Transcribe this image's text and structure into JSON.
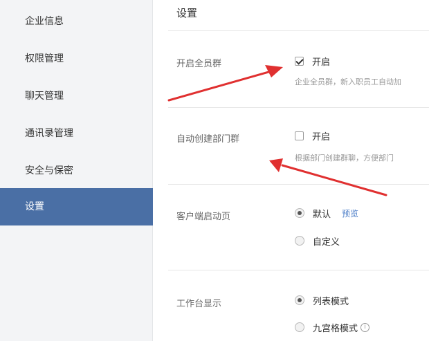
{
  "sidebar": {
    "items": [
      {
        "label": "企业信息"
      },
      {
        "label": "权限管理"
      },
      {
        "label": "聊天管理"
      },
      {
        "label": "通讯录管理"
      },
      {
        "label": "安全与保密"
      },
      {
        "label": "设置"
      }
    ]
  },
  "main": {
    "title": "设置",
    "all_staff_group": {
      "label": "开启全员群",
      "option": "开启",
      "checked": true,
      "desc": "企业全员群，新入职员工自动加"
    },
    "dept_group": {
      "label": "自动创建部门群",
      "option": "开启",
      "checked": false,
      "desc": "根据部门创建群聊，方便部门"
    },
    "client_start_page": {
      "label": "客户端启动页",
      "options": [
        "默认",
        "自定义"
      ],
      "selected": "默认",
      "preview_link": "预览"
    },
    "workbench_display": {
      "label": "工作台显示",
      "options": [
        "列表模式",
        "九宫格模式"
      ],
      "selected": "列表模式",
      "info_icon": "i"
    }
  },
  "colors": {
    "sidebar_active_bg": "#4a6fa5",
    "arrow": "#e03030",
    "link": "#4a7cc7"
  }
}
